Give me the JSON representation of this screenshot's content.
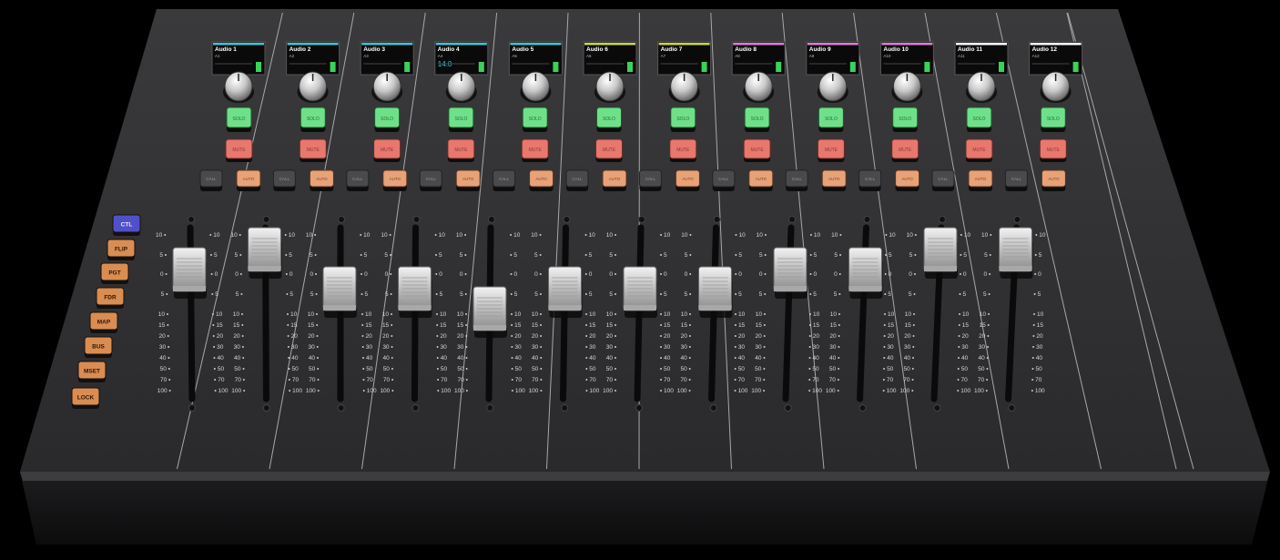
{
  "channels": [
    {
      "name": "Audio 1",
      "sub": "A1",
      "accent": "#37c7d8",
      "fader_db": 5,
      "extra": ""
    },
    {
      "name": "Audio 2",
      "sub": "A2",
      "accent": "#37c7d8",
      "fader_db": 10,
      "extra": ""
    },
    {
      "name": "Audio 3",
      "sub": "A3",
      "accent": "#37c7d8",
      "fader_db": 0,
      "extra": ""
    },
    {
      "name": "Audio 4",
      "sub": "A4",
      "accent": "#37c7d8",
      "fader_db": 0,
      "extra": "14.0"
    },
    {
      "name": "Audio 5",
      "sub": "A5",
      "accent": "#37c7d8",
      "fader_db": -5,
      "extra": ""
    },
    {
      "name": "Audio 6",
      "sub": "A6",
      "accent": "#c9d83a",
      "fader_db": 0,
      "extra": ""
    },
    {
      "name": "Audio 7",
      "sub": "A7",
      "accent": "#c9d83a",
      "fader_db": 0,
      "extra": ""
    },
    {
      "name": "Audio 8",
      "sub": "A8",
      "accent": "#e07ad8",
      "fader_db": 0,
      "extra": ""
    },
    {
      "name": "Audio 9",
      "sub": "A9",
      "accent": "#e07ad8",
      "fader_db": 5,
      "extra": ""
    },
    {
      "name": "Audio 10",
      "sub": "A10",
      "accent": "#e07ad8",
      "fader_db": 5,
      "extra": ""
    },
    {
      "name": "Audio 11",
      "sub": "A11",
      "accent": "#ffffff",
      "fader_db": 10,
      "extra": ""
    },
    {
      "name": "Audio 12",
      "sub": "A12",
      "accent": "#ffffff",
      "fader_db": 10,
      "extra": ""
    }
  ],
  "buttons": {
    "solo": "SOLO",
    "mute": "MUTE",
    "call": "CALL",
    "auto": "AUTO"
  },
  "scale": {
    "upper": [
      "10",
      "5",
      "0",
      "5"
    ],
    "lower": [
      "10",
      "15",
      "20",
      "30",
      "40",
      "50",
      "70",
      "100"
    ]
  },
  "side_buttons": [
    "CTL",
    "FLIP",
    "PGT",
    "FDR",
    "MAP",
    "BUS",
    "MSET",
    "LOCK"
  ],
  "colors": {
    "panel": "#2b2b2d",
    "solo": "#6fe08a",
    "mute": "#e8776e",
    "call": "#4a4a4c",
    "auto": "#e8a278",
    "side": "#d98d52",
    "ctl": "#5050c8"
  }
}
